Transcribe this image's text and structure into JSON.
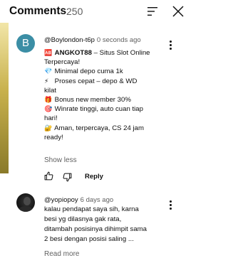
{
  "header": {
    "title": "Comments",
    "count": "250"
  },
  "comments": [
    {
      "avatar_letter": "B",
      "author": "@Boylondon-t6p",
      "time": "0 seconds ago",
      "lines": [
        {
          "icon": "🆎",
          "icon_name": "slot-icon",
          "bold": "ANGKOT88",
          "text": " – Situs Slot Online"
        },
        {
          "icon": "",
          "icon_name": "",
          "bold": "",
          "text": "Terpercaya!"
        },
        {
          "icon": "💎",
          "icon_name": "diamond-icon",
          "bold": "",
          "text": "Minimal depo cuma 1k"
        },
        {
          "icon": "⚡",
          "icon_name": "lightning-icon",
          "bold": "",
          "text": "Proses cepat – depo & WD"
        },
        {
          "icon": "",
          "icon_name": "",
          "bold": "",
          "text": "kilat"
        },
        {
          "icon": "🎁",
          "icon_name": "gift-icon",
          "bold": "",
          "text": "Bonus new member 30%"
        },
        {
          "icon": "🎯",
          "icon_name": "target-icon",
          "bold": "",
          "text": "Winrate tinggi, auto cuan tiap"
        },
        {
          "icon": "",
          "icon_name": "",
          "bold": "",
          "text": "hari!"
        },
        {
          "icon": "🔐",
          "icon_name": "lock-icon",
          "bold": "",
          "text": "Aman, terpercaya, CS 24 jam"
        },
        {
          "icon": "",
          "icon_name": "",
          "bold": "",
          "text": "ready!"
        }
      ],
      "toggle_label": "Show less",
      "reply_label": "Reply"
    },
    {
      "author": "@yopiopoy",
      "time": "6 days ago",
      "lines": [
        "kalau pendapat saya sih, karna",
        "besi yg dilasnya  gak rata,",
        "ditambah posisinya dihimpit sama",
        "2 besi dengan posisi saling ..."
      ],
      "toggle_label": "Read more"
    }
  ],
  "colors": {
    "accent_avatar": "#3b8ea5",
    "secondary_text": "#606060",
    "strip_gold": "#c8b14c"
  }
}
